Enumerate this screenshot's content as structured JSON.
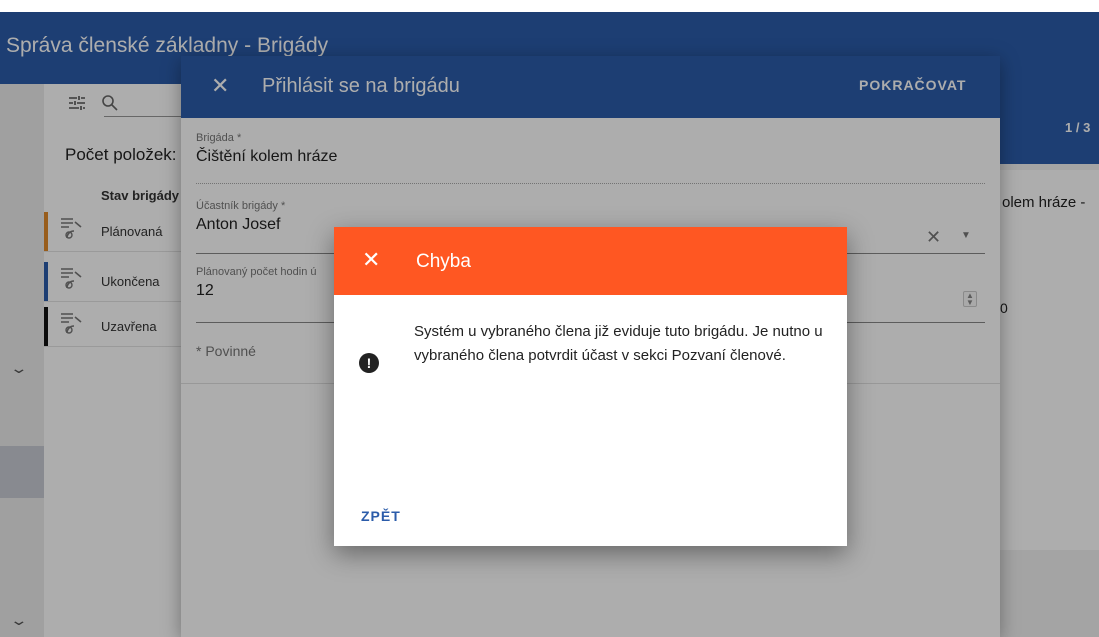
{
  "app": {
    "title": "Správa členské základny - Brigády",
    "count_label": "Počet položek:",
    "column_header": "Stav brigády",
    "page_indicator": "1 / 3",
    "detail_title": "olem hráze -",
    "detail_value": "0"
  },
  "status_list": [
    {
      "label": "Plánovaná",
      "color": "#e0892a"
    },
    {
      "label": "Ukončena",
      "color": "#2b5caa"
    },
    {
      "label": "Uzavřena",
      "color": "#111111"
    }
  ],
  "form_dialog": {
    "title": "Přihlásit se na brigádu",
    "continue_label": "POKRAČOVAT",
    "fields": {
      "brigade": {
        "label": "Brigáda *",
        "value": "Čištění kolem hráze"
      },
      "participant": {
        "label": "Účastník brigády *",
        "value": "Anton Josef"
      },
      "hours": {
        "label": "Plánovaný počet hodin ú",
        "value": "12"
      }
    },
    "required_note": "* Povinné"
  },
  "error_dialog": {
    "title": "Chyba",
    "message": "Systém u vybraného člena již eviduje tuto brigádu. Je nutno u vybraného člena potvrdit účast v sekci Pozvaní členové.",
    "back_label": "ZPĚT",
    "icon": "exclamation-circle-icon"
  },
  "colors": {
    "primary": "#2b5caa",
    "error_header": "#ff5722"
  }
}
